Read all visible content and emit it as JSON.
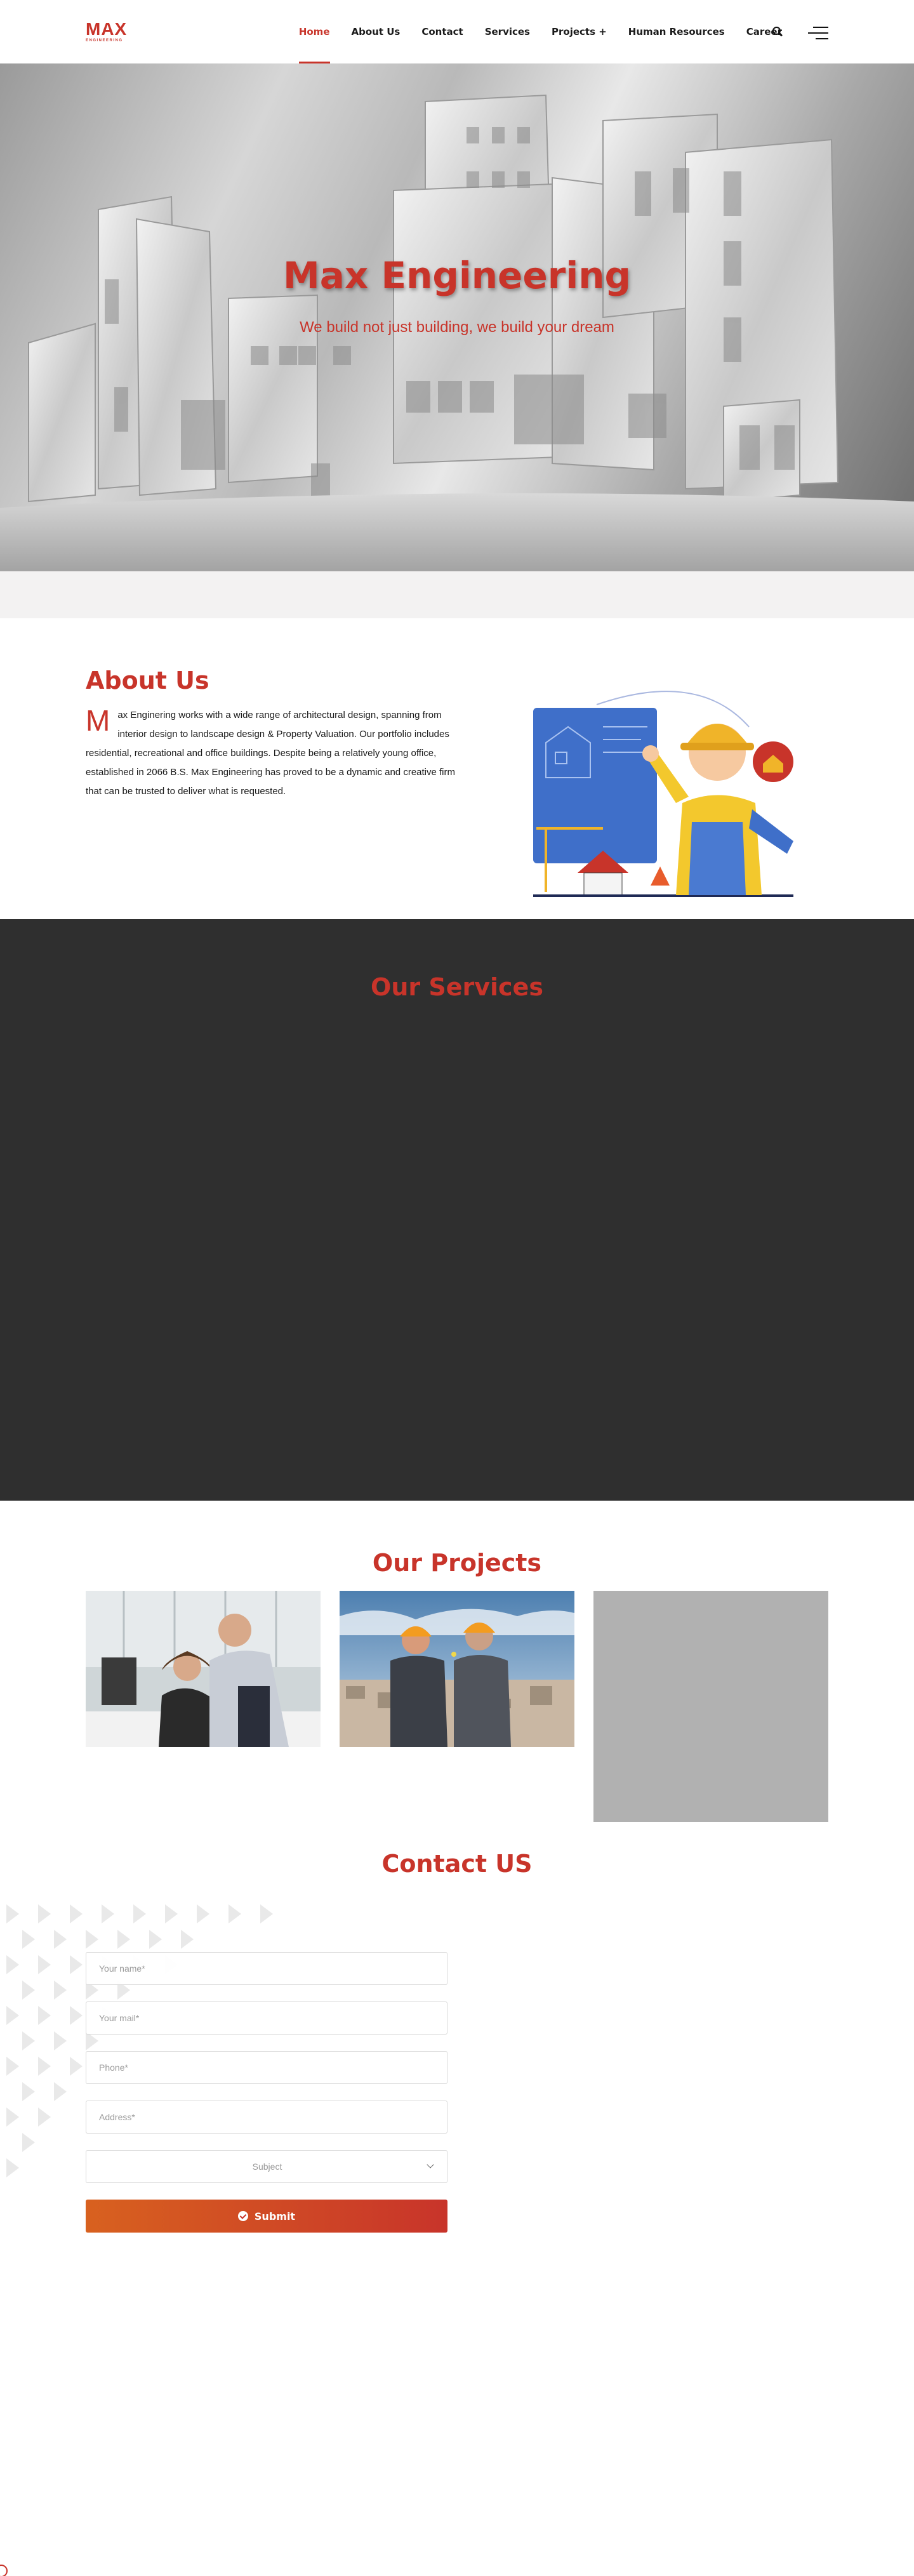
{
  "brand": {
    "name": "MAX",
    "tagline": "ENGINEERING",
    "color": "#c8342a"
  },
  "nav": {
    "items": [
      {
        "label": "Home",
        "active": true
      },
      {
        "label": "About Us"
      },
      {
        "label": "Contact"
      },
      {
        "label": "Services"
      },
      {
        "label": "Projects +"
      },
      {
        "label": "Human Resources"
      },
      {
        "label": "Career"
      }
    ],
    "icons": [
      "search-icon",
      "menu-icon"
    ]
  },
  "hero": {
    "title": "Max Engineering",
    "subtitle": "We build not just building, we build your dream"
  },
  "about": {
    "title": "About Us",
    "dropcap": "M",
    "text": "ax Enginering works with a wide range of architectural design, spanning from interior design to landscape design & Property Valuation. Our portfolio includes residential, recreational and office buildings. Despite being a relatively young office, established in 2066 B.S. Max Engineering has proved to be a dynamic and creative firm that can be trusted to deliver what is requested."
  },
  "services": {
    "title": "Our Services"
  },
  "projects": {
    "title": "Our Projects"
  },
  "contact": {
    "title": "Contact US",
    "fields": {
      "name": "Your name*",
      "mail": "Your mail*",
      "phone": "Phone*",
      "address": "Address*"
    },
    "subject": "Subject",
    "submit": "Submit"
  }
}
